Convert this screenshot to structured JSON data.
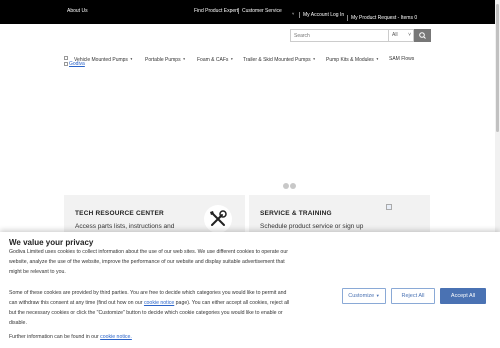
{
  "topbar": {
    "about": "About Us",
    "find_expert": "Find Product Expert",
    "customer_service": "Customer Service",
    "account": "My Account Log In",
    "request": "My Product Request - Items 0"
  },
  "search": {
    "placeholder": "Search",
    "scope": "All"
  },
  "nav": {
    "items": [
      {
        "label": "Vehicle Mounted Pumps"
      },
      {
        "label": "Portable Pumps"
      },
      {
        "label": "Foam & CAFs"
      },
      {
        "label": "Trailer & Skid Mounted Pumps"
      },
      {
        "label": "Pump Kits & Modules"
      },
      {
        "label": "SAM Flows"
      }
    ],
    "image_alt": "Godiva"
  },
  "cards": {
    "tech": {
      "title": "TECH RESOURCE CENTER",
      "desc": "Access parts lists, instructions and"
    },
    "service": {
      "title": "SERVICE & TRAINING",
      "desc": "Schedule product service or sign up"
    }
  },
  "cookie": {
    "heading": "We value your privacy",
    "p1_line1": "Godiva Limited uses cookies to collect information about the use of our web sites. We use different cookies to operate our",
    "p1_line2": "website, analyze the use of the website, improve the performance of our website and display suitable advertisement that",
    "p1_line3": "might be relevant to you.",
    "p2_line1": "Some of these cookies are provided by third parties. You are free to decide which categories you would like to permit and",
    "p2_line2_pre": "can withdraw this consent at any time (find out how on our ",
    "p2_link": "cookie notice",
    "p2_line2_post": " page). You can either accept all cookies, reject all",
    "p2_line3": "but the necessary cookies or click the \"Customize\" button to decide which cookie categories you would like to enable or",
    "p2_line4": "disable.",
    "p3_pre": "Further information can be found in our ",
    "p3_link": "cookie notice.",
    "customize": "Customize",
    "reject": "Reject All",
    "accept": "Accept All"
  }
}
